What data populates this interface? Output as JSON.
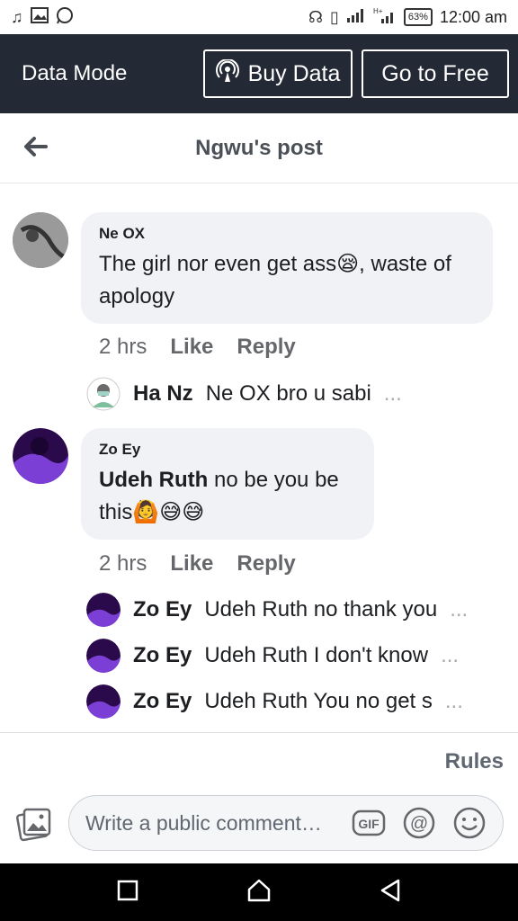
{
  "status_bar": {
    "time": "12:00 am",
    "battery": "63%"
  },
  "data_mode": {
    "label": "Data Mode",
    "buy_label": "Buy Data",
    "free_label": "Go to Free"
  },
  "header": {
    "title": "Ngwu's post"
  },
  "comments": [
    {
      "name": "Ne OX",
      "text": "The girl nor even get ass😪, waste of apology",
      "time": "2 hrs",
      "like": "Like",
      "reply": "Reply",
      "replies": [
        {
          "name": "Ha Nz",
          "text": "Ne OX  bro u sabi",
          "more": "..."
        }
      ]
    },
    {
      "name": "Zo Ey",
      "mention": "Udeh Ruth",
      "text_line1": " no be you be",
      "text_line2": "this🙆😅😅",
      "time": "2 hrs",
      "like": "Like",
      "reply": "Reply",
      "replies": [
        {
          "name": "Zo Ey",
          "text": "Udeh Ruth no thank you",
          "more": "..."
        },
        {
          "name": "Zo Ey",
          "text": "Udeh Ruth I don't know",
          "more": "..."
        },
        {
          "name": "Zo Ey",
          "text": "Udeh Ruth You no get s",
          "more": "..."
        }
      ]
    }
  ],
  "rules_label": "Rules",
  "composer": {
    "placeholder": "Write a public comment…"
  },
  "icons": {
    "back": "arrow-left-icon",
    "gif": "gif-icon",
    "sticker": "at-icon",
    "emoji": "smiley-icon",
    "photo": "photo-icon"
  }
}
